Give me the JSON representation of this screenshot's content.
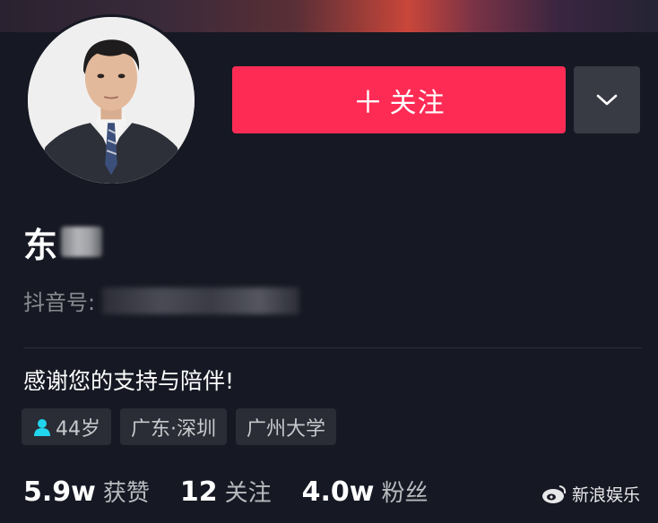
{
  "profile": {
    "follow_label": "关注",
    "name": "东",
    "id_label": "抖音号:",
    "bio": "感谢您的支持与陪伴!",
    "tags": {
      "age": "44岁",
      "location": "广东·深圳",
      "school": "广州大学"
    },
    "stats": [
      {
        "value": "5.9w",
        "label": "获赞"
      },
      {
        "value": "12",
        "label": "关注"
      },
      {
        "value": "4.0w",
        "label": "粉丝"
      }
    ]
  },
  "watermark": {
    "text": "新浪娱乐"
  },
  "colors": {
    "background": "#161823",
    "follow_button": "#fe2c55",
    "secondary_button": "#393b44",
    "tag_background": "#2a2c36",
    "age_icon": "#20d5ec"
  },
  "icons": {
    "follow": "plus-icon",
    "more": "chevron-down-icon",
    "age": "person-icon",
    "watermark": "weibo-logo-icon"
  }
}
